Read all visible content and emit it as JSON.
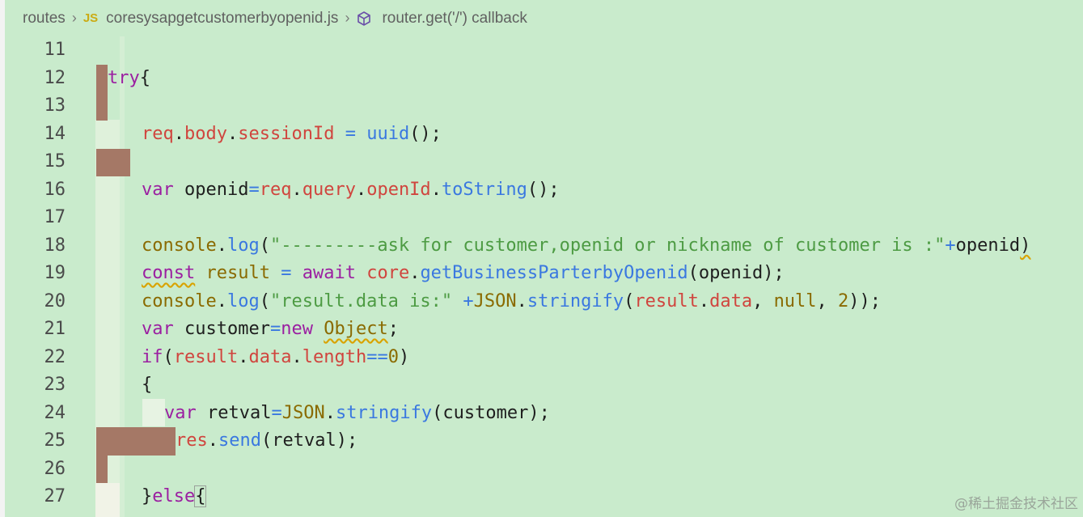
{
  "breadcrumb": {
    "folder": "routes",
    "file_badge": "JS",
    "file": "coresysapgetcustomerbyopenid.js",
    "symbol": "router.get('/') callback"
  },
  "lines": [
    {
      "n": "11",
      "code": ""
    },
    {
      "n": "12",
      "code": "try{"
    },
    {
      "n": "13",
      "code": ""
    },
    {
      "n": "14",
      "code": "req.body.sessionId = uuid();"
    },
    {
      "n": "15",
      "code": ""
    },
    {
      "n": "16",
      "code": "var openid=req.query.openId.toString();"
    },
    {
      "n": "17",
      "code": ""
    },
    {
      "n": "18",
      "code": "console.log(\"---------ask for customer,openid or nickname of customer is :\"+openid)"
    },
    {
      "n": "19",
      "code": "const result = await core.getBusinessParterbyOpenid(openid);"
    },
    {
      "n": "20",
      "code": "console.log(\"result.data is:\" +JSON.stringify(result.data, null, 2));"
    },
    {
      "n": "21",
      "code": "var customer=new Object;"
    },
    {
      "n": "22",
      "code": "if(result.data.length==0)"
    },
    {
      "n": "23",
      "code": "{"
    },
    {
      "n": "24",
      "code": "var retval=JSON.stringify(customer);"
    },
    {
      "n": "25",
      "code": "res.send(retval);"
    },
    {
      "n": "26",
      "code": ""
    },
    {
      "n": "27",
      "code": "}else{"
    }
  ],
  "watermark": "@稀土掘金技术社区",
  "colors": {
    "background": "#c9ebcc",
    "keyword": "#9b1fa1",
    "property": "#d0453e",
    "function": "#3a78e0",
    "string": "#4d9b43",
    "number": "#8a6a00",
    "highlight_block": "#a57866"
  },
  "icons": [
    "chevron-right-icon",
    "js-file-icon",
    "cube-method-icon"
  ]
}
